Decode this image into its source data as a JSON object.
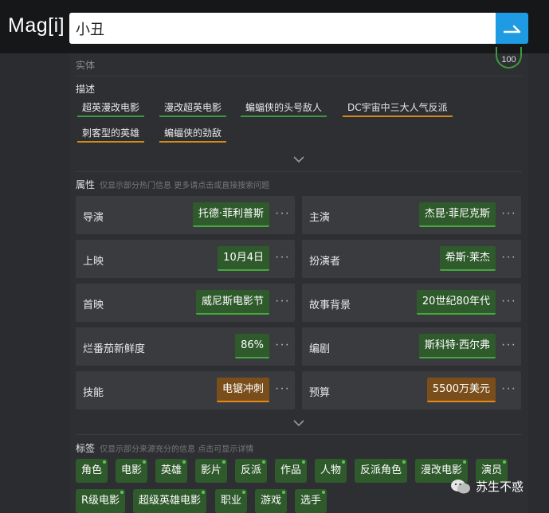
{
  "app": {
    "logo": "Mag[i]"
  },
  "search": {
    "value": "小丑"
  },
  "entity": {
    "type_label": "实体",
    "score": "100"
  },
  "description": {
    "title": "描述",
    "tags": [
      "超英漫改电影",
      "漫改超英电影",
      "蝙蝠侠的头号敌人",
      "DC宇宙中三大人气反派",
      "刺客型的英雄",
      "蝙蝠侠的劲敌"
    ]
  },
  "attributes": {
    "title": "属性",
    "hint": "仅显示部分热门信息  更多请点击或直接搜索问题",
    "items": [
      {
        "label": "导演",
        "value": "托德·菲利普斯",
        "status": "green"
      },
      {
        "label": "主演",
        "value": "杰昆·菲尼克斯",
        "status": "green"
      },
      {
        "label": "上映",
        "value": "10月4日",
        "status": "green"
      },
      {
        "label": "扮演者",
        "value": "希斯·莱杰",
        "status": "green"
      },
      {
        "label": "首映",
        "value": "威尼斯电影节",
        "status": "green"
      },
      {
        "label": "故事背景",
        "value": "20世纪80年代",
        "status": "green"
      },
      {
        "label": "烂番茄新鲜度",
        "value": "86%",
        "status": "green"
      },
      {
        "label": "编剧",
        "value": "斯科特·西尔弗",
        "status": "green"
      },
      {
        "label": "技能",
        "value": "电锯冲刺",
        "status": "orange"
      },
      {
        "label": "预算",
        "value": "5500万美元",
        "status": "orange"
      }
    ],
    "more_symbol": "···"
  },
  "tags": {
    "title": "标签",
    "hint": "仅显示部分来源充分的信息  点击可显示详情",
    "items": [
      "角色",
      "电影",
      "英雄",
      "影片",
      "反派",
      "作品",
      "人物",
      "反派角色",
      "漫改电影",
      "演员",
      "R级电影",
      "超级英雄电影",
      "职业",
      "游戏",
      "选手"
    ]
  },
  "watermark": {
    "text": "苏生不惑"
  },
  "colors": {
    "accent": "#1e9be3",
    "green": "#3c9a3c",
    "orange": "#d28a1e"
  }
}
